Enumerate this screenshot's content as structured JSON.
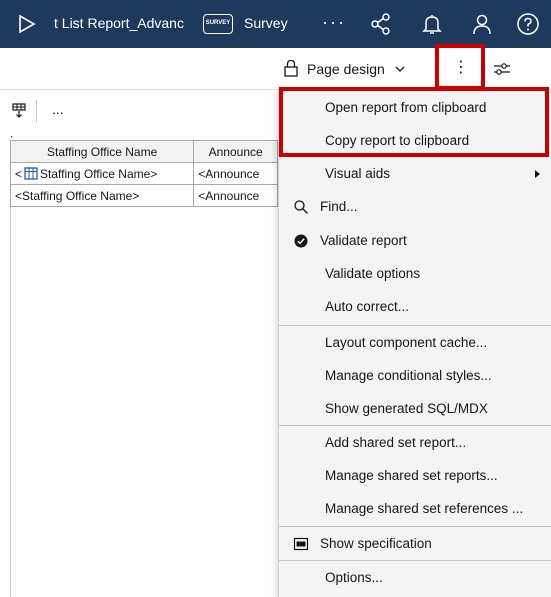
{
  "topbar": {
    "title": "t List Report_Advanc",
    "survey_icon_text": "SURVEY",
    "survey_label": "Survey",
    "more_label": "···",
    "bg_color": "#1d3a5c"
  },
  "toolbar": {
    "page_design_label": "Page design",
    "kebab_label": "⋮"
  },
  "toolbar3": {
    "more_label": "..."
  },
  "report": {
    "headers": [
      "Staffing Office Name",
      "Announce"
    ],
    "rows": [
      [
        "<",
        "Staffing Office Name>",
        "<Announce"
      ],
      [
        "<Staffing Office Name>",
        "<Announce"
      ]
    ]
  },
  "menu": {
    "items": [
      {
        "label": "Open report from clipboard"
      },
      {
        "label": "Copy report to clipboard"
      },
      {
        "label": "Visual aids"
      },
      {
        "label": "Find..."
      },
      {
        "label": "Validate report"
      },
      {
        "label": "Validate options"
      },
      {
        "label": "Auto correct..."
      },
      {
        "label": "Layout component cache..."
      },
      {
        "label": "Manage conditional styles..."
      },
      {
        "label": "Show generated SQL/MDX"
      },
      {
        "label": "Add shared set report..."
      },
      {
        "label": "Manage shared set reports..."
      },
      {
        "label": "Manage shared set references ..."
      },
      {
        "label": "Show specification"
      },
      {
        "label": "Options..."
      }
    ]
  },
  "colors": {
    "highlight": "#cc0000",
    "menu_bg": "#f4f4f4"
  }
}
